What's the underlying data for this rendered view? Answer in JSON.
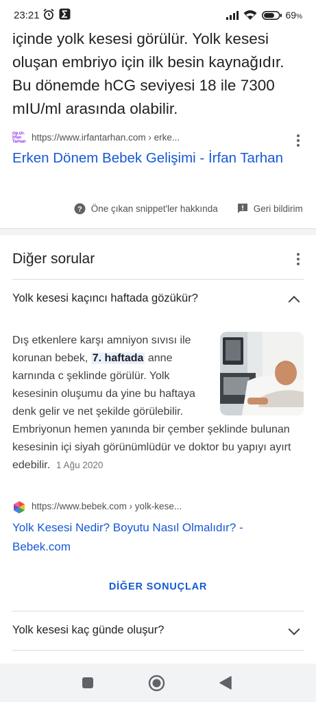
{
  "status_bar": {
    "time": "23:21",
    "battery": "69"
  },
  "snippet": {
    "text": "içinde yolk kesesi görülür. Yolk kesesi oluşan embriyo için ilk besin kaynağıdır. Bu dönemde hCG seviyesi 18 ile 7300 mIU/ml arasında olabilir.",
    "favicon_text": "Op.Dr. İrfan Tarhan",
    "source_url": "https://www.irfantarhan.com › erke...",
    "title": "Erken Dönem Bebek Gelişimi - İrfan Tarhan",
    "about_label": "Öne çıkan snippet'ler hakkında",
    "feedback_label": "Geri bildirim"
  },
  "related": {
    "title": "Diğer sorular",
    "q1": {
      "question": "Yolk kesesi kaçıncı haftada gözükür?",
      "answer_before": "Dış etkenlere karşı amniyon sıvısı ile korunan bebek, ",
      "answer_highlight": "7. haftada",
      "answer_after": " anne karnında c şeklinde görülür. Yolk kesesinin oluşumu da yine bu haftaya denk gelir ve net şekilde görülebilir. Embriyonun hemen yanında bir çember şeklinde bulunan kesesinin içi siyah görünümlüdür ve doktor bu yapıyı ayırt edebilir.",
      "date": "1 Ağu 2020",
      "source_url": "https://www.bebek.com › yolk-kese...",
      "result_title": "Yolk Kesesi Nedir? Boyutu Nasıl Olmalıdır? - Bebek.com",
      "more_label": "DİĞER SONUÇLAR"
    },
    "q2": {
      "question": "Yolk kesesi kaç günde oluşur?"
    }
  },
  "colors": {
    "link": "#1558d6",
    "text": "#202124",
    "highlight": "#e8f0fe"
  }
}
